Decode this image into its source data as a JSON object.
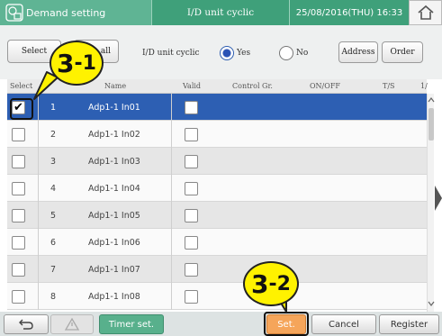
{
  "header": {
    "title": "Demand setting",
    "mode": "I/D unit cyclic",
    "datetime": "25/08/2016(THU) 16:33"
  },
  "toolbar": {
    "select_all_label": "Select",
    "clear_all_label": "all",
    "cyclic_label": "I/D unit cyclic",
    "yes_label": "Yes",
    "no_label": "No",
    "cyclic_value": "Yes",
    "address_label": "Address",
    "order_label": "Order"
  },
  "table": {
    "columns": [
      "Select",
      "Name",
      "Valid",
      "Control Gr.",
      "ON/OFF",
      "T/S",
      "1/"
    ],
    "rows": [
      {
        "num": "1",
        "name": "Adp1-1 In01",
        "selected": true,
        "valid": false
      },
      {
        "num": "2",
        "name": "Adp1-1 In02",
        "selected": false,
        "valid": false
      },
      {
        "num": "3",
        "name": "Adp1-1 In03",
        "selected": false,
        "valid": false
      },
      {
        "num": "4",
        "name": "Adp1-1 In04",
        "selected": false,
        "valid": false
      },
      {
        "num": "5",
        "name": "Adp1-1 In05",
        "selected": false,
        "valid": false
      },
      {
        "num": "6",
        "name": "Adp1-1 In06",
        "selected": false,
        "valid": false
      },
      {
        "num": "7",
        "name": "Adp1-1 In07",
        "selected": false,
        "valid": false
      },
      {
        "num": "8",
        "name": "Adp1-1 In08",
        "selected": false,
        "valid": false
      }
    ]
  },
  "footer": {
    "timer_label": "Timer set.",
    "set_label": "Set.",
    "cancel_label": "Cancel",
    "register_label": "Register"
  },
  "callouts": {
    "c1_main": "3",
    "c1_sub": "-1",
    "c2_main": "3",
    "c2_sub": "-2"
  },
  "colors": {
    "header_green": "#3fa07a",
    "selected_row": "#2d5fb3",
    "set_button": "#f5a55a",
    "timer_button": "#58b08c",
    "callout_yellow": "#fff200"
  }
}
